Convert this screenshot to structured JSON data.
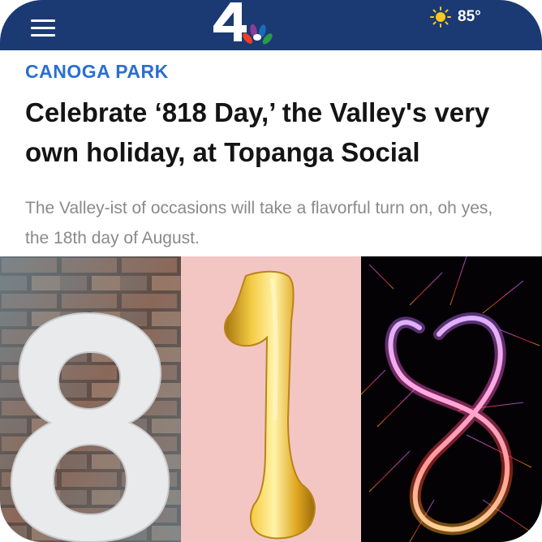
{
  "header": {
    "menu_icon": "hamburger-menu-icon",
    "logo_icon": "nbc-4-peacock-logo",
    "weather": {
      "icon": "sun-icon",
      "temperature": "85°"
    },
    "colors": {
      "background": "#1b3a73"
    }
  },
  "article": {
    "category": "CANOGA PARK",
    "headline": "Celebrate ‘818 Day,’ the Valley's very own holiday, at Topanga Social",
    "summary": "The Valley-ist of occasions will take a flavorful turn on, oh yes, the 18th day of August.",
    "colors": {
      "category": "#2a6fcf",
      "headline": "#141414",
      "summary": "#8a8a8a"
    }
  },
  "hero_image": {
    "panels": [
      {
        "name": "white-8-on-brick",
        "background": "#6b4536"
      },
      {
        "name": "gold-balloon-1-on-pink",
        "background": "#f3c6c4"
      },
      {
        "name": "sparkler-8-on-black",
        "background": "#050205"
      }
    ]
  }
}
